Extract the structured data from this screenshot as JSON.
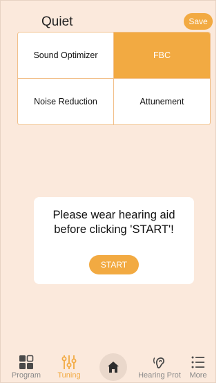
{
  "header": {
    "title": "Quiet",
    "save_label": "Save"
  },
  "grid": {
    "items": [
      {
        "label": "Sound Optimizer",
        "active": false
      },
      {
        "label": "FBC",
        "active": true
      },
      {
        "label": "Noise Reduction",
        "active": false
      },
      {
        "label": "Attunement",
        "active": false
      }
    ]
  },
  "dialog": {
    "message_line1": "Please wear hearing aid",
    "message_line2": "before clicking 'START'!",
    "start_label": "START"
  },
  "nav": {
    "items": [
      {
        "label": "Program",
        "icon": "program-grid-icon",
        "active": false
      },
      {
        "label": "Tuning",
        "icon": "tuning-sliders-icon",
        "active": true
      },
      {
        "label": "Hearing Prot",
        "icon": "ear-icon",
        "active": false
      },
      {
        "label": "More",
        "icon": "menu-list-icon",
        "active": false
      }
    ],
    "home_icon": "home-icon"
  },
  "colors": {
    "background": "#fbe9dc",
    "accent": "#f2aa42",
    "border": "#f2c08a",
    "inactive_text": "#8a8a8a"
  }
}
